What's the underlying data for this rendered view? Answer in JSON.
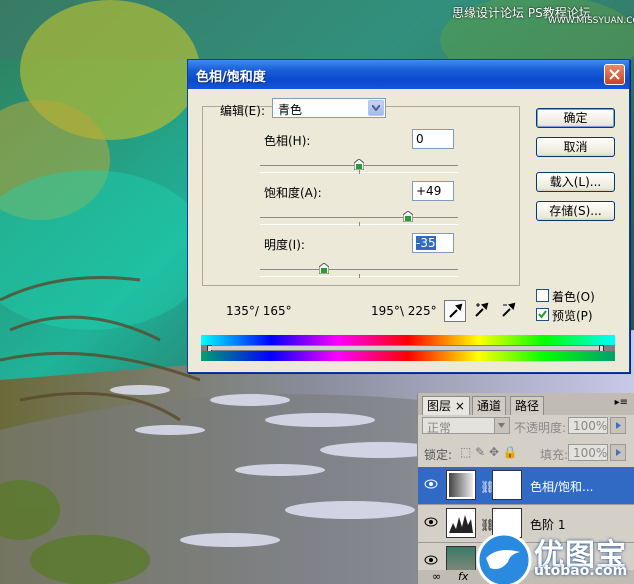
{
  "watermark": {
    "line1": "思缘设计论坛",
    "line2": "WWW.MISSYUAN.COM",
    "line3": "PS教程论坛"
  },
  "dialog": {
    "title": "色相/饱和度",
    "edit_label": "编辑(E):",
    "edit_value": "青色",
    "hue": {
      "label": "色相(H):",
      "value": "0",
      "position": 0.5
    },
    "saturation": {
      "label": "饱和度(A):",
      "value": "+49",
      "position": 0.745
    },
    "lightness": {
      "label": "明度(I):",
      "value": "-35",
      "position": 0.325
    },
    "range_left": "135°/ 165°",
    "range_right": "195°\\ 225°",
    "buttons": {
      "ok": "确定",
      "cancel": "取消",
      "load": "载入(L)...",
      "save": "存储(S)..."
    },
    "colorize": {
      "label": "着色(O)",
      "checked": false
    },
    "preview": {
      "label": "预览(P)",
      "checked": true
    }
  },
  "layers_panel": {
    "tabs": [
      "图层",
      "通道",
      "路径"
    ],
    "blend_mode": "正常",
    "opacity_label": "不透明度:",
    "opacity_value": "100%",
    "lock_label": "锁定:",
    "fill_label": "填充:",
    "fill_value": "100%",
    "layers": [
      {
        "name": "色相/饱和...",
        "selected": true
      },
      {
        "name": "色阶 1",
        "selected": false
      },
      {
        "name": "",
        "selected": false
      }
    ]
  },
  "logo": {
    "text": "优图宝",
    "url": "utobao.com"
  },
  "colors": {
    "title_bar": "#0b49cc",
    "dialog_bg": "#ece9d8",
    "selected_layer": "#316ac5"
  }
}
